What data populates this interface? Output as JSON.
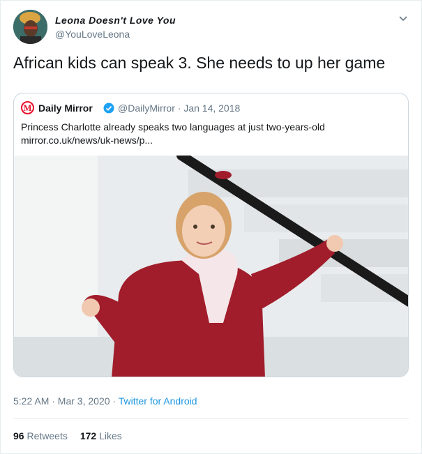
{
  "author": {
    "name": "Leona Doesn't Love You",
    "handle": "@YouLoveLeona"
  },
  "tweet": {
    "text": "African kids can speak 3. She needs to up her game"
  },
  "quoted": {
    "logo_letter": "M",
    "name": "Daily Mirror",
    "handle_date": "@DailyMirror · Jan 14, 2018",
    "text": "Princess Charlotte already speaks two languages at just two-years-old",
    "link": "mirror.co.uk/news/uk-news/p..."
  },
  "meta": {
    "time_date": "5:22 AM · Mar 3, 2020 · ",
    "app": "Twitter for Android"
  },
  "stats": {
    "retweets_count": "96",
    "retweets_label": "Retweets",
    "likes_count": "172",
    "likes_label": "Likes"
  },
  "icons": {
    "caret": "chevron-down-icon",
    "verified": "verified-badge-icon"
  },
  "colors": {
    "link_blue": "#1b95e0",
    "verified_blue": "#1da1f2",
    "mirror_red": "#e8102a",
    "muted": "#657786"
  }
}
